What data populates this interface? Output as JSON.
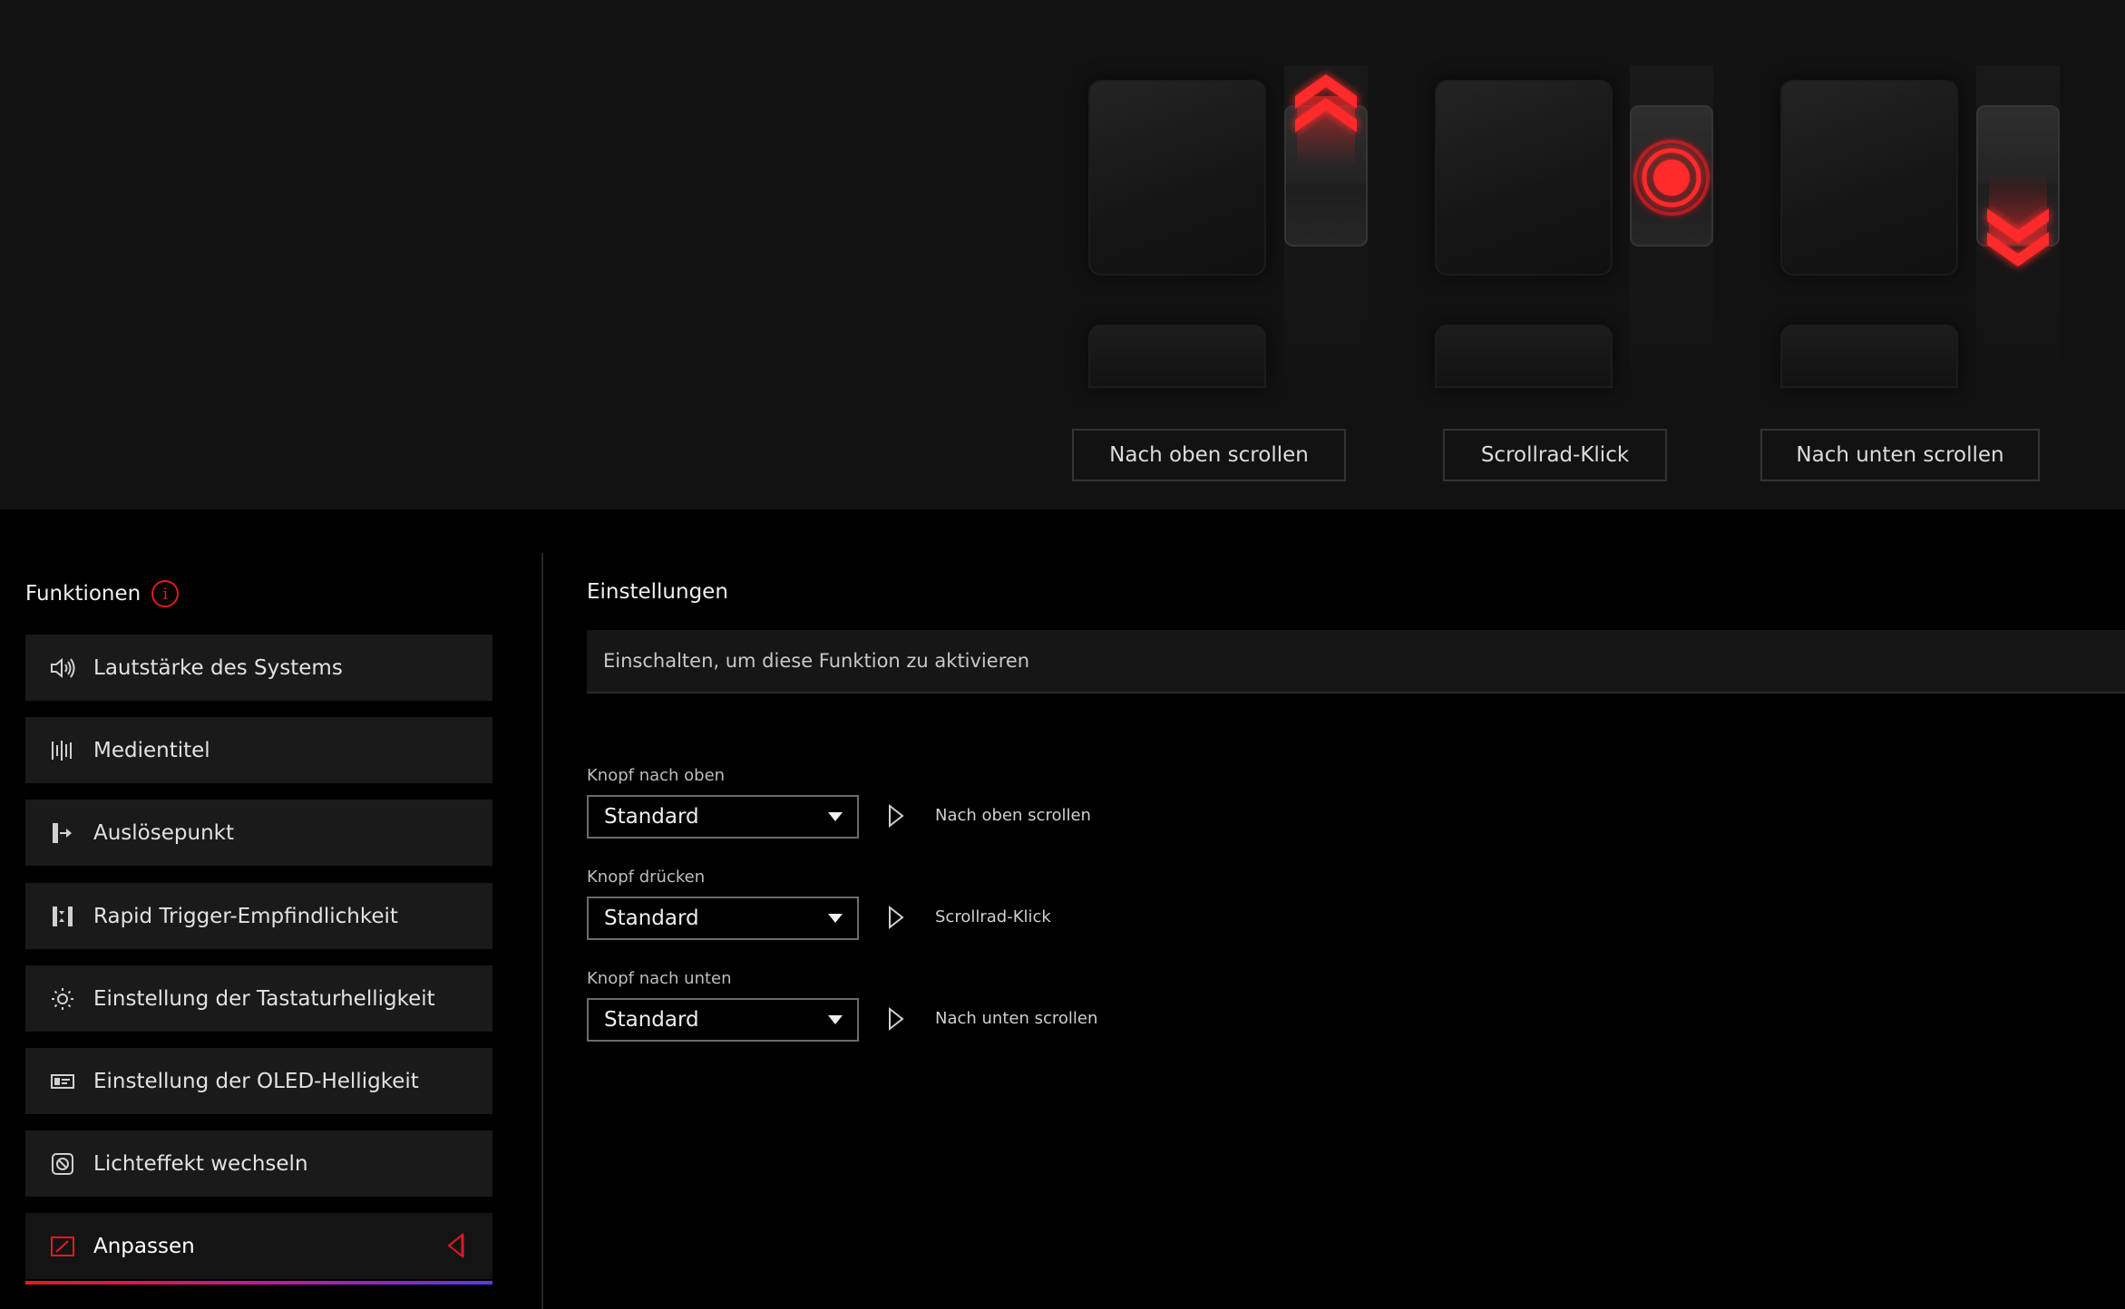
{
  "preview": {
    "buttons": [
      "Nach oben scrollen",
      "Scrollrad-Klick",
      "Nach unten scrollen"
    ]
  },
  "functions": {
    "title": "Funktionen",
    "info_glyph": "i",
    "items": [
      {
        "label": "Lautstärke des Systems",
        "icon": "speaker-icon"
      },
      {
        "label": "Medientitel",
        "icon": "media-bars-icon"
      },
      {
        "label": "Auslösepunkt",
        "icon": "actuation-point-icon"
      },
      {
        "label": "Rapid Trigger-Empfindlichkeit",
        "icon": "rapid-trigger-icon"
      },
      {
        "label": "Einstellung der Tastaturhelligkeit",
        "icon": "brightness-icon"
      },
      {
        "label": "Einstellung der OLED-Helligkeit",
        "icon": "oled-icon"
      },
      {
        "label": "Lichteffekt wechseln",
        "icon": "light-effect-icon"
      },
      {
        "label": "Anpassen",
        "icon": "customize-icon",
        "active": true
      }
    ]
  },
  "settings": {
    "title": "Einstellungen",
    "enable_text": "Einschalten, um diese Funktion zu aktivieren",
    "rows": [
      {
        "label": "Knopf nach oben",
        "value": "Standard",
        "assigned": "Nach oben scrollen"
      },
      {
        "label": "Knopf drücken",
        "value": "Standard",
        "assigned": "Scrollrad-Klick"
      },
      {
        "label": "Knopf nach unten",
        "value": "Standard",
        "assigned": "Nach unten scrollen"
      }
    ]
  },
  "colors": {
    "accent": "#e01a22",
    "background": "#000000",
    "panel": "#1a1a1a",
    "preview_bg": "#121212"
  }
}
